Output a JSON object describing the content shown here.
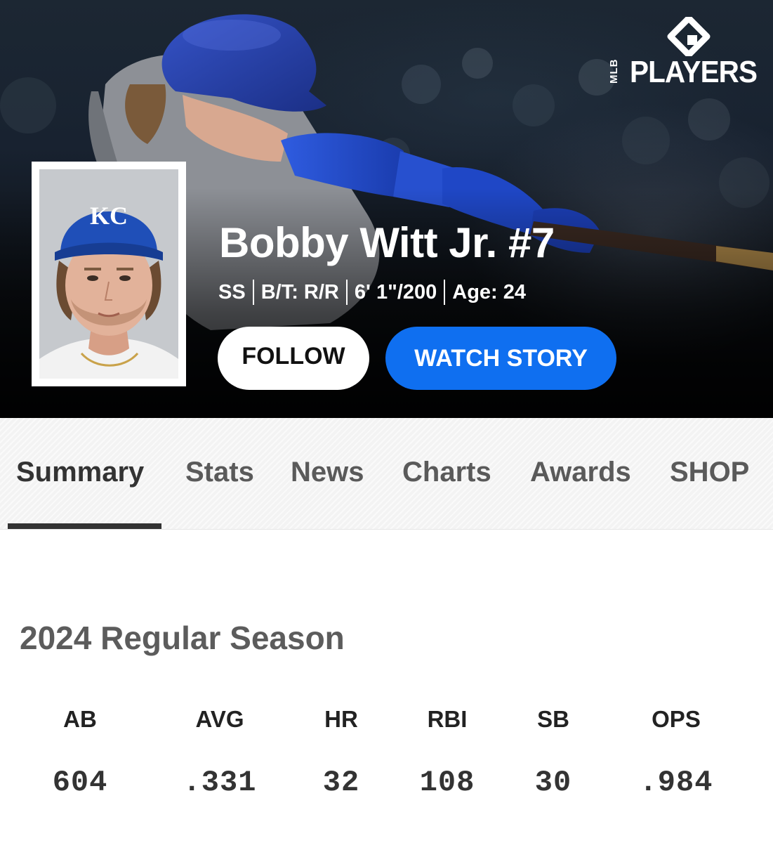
{
  "brand": {
    "logo_small": "MLB",
    "logo_word": "PLAYERS",
    "logo_icon": "mlb-players-diamond-icon"
  },
  "player": {
    "name": "Bobby Witt Jr. #7",
    "position": "SS",
    "bats_throws": "B/T: R/R",
    "height_weight": "6' 1\"/200",
    "age": "Age: 24",
    "team_logo_text": "KC"
  },
  "actions": {
    "follow_label": "FOLLOW",
    "watch_label": "WATCH STORY"
  },
  "colors": {
    "accent_blue": "#0f6ff0",
    "royals_blue": "#1d4fb5",
    "tab_active": "#333333",
    "tab_inactive": "#5a5a5a"
  },
  "tabs": [
    {
      "label": "Summary",
      "active": true
    },
    {
      "label": "Stats",
      "active": false
    },
    {
      "label": "News",
      "active": false
    },
    {
      "label": "Charts",
      "active": false
    },
    {
      "label": "Awards",
      "active": false
    },
    {
      "label": "SHOP",
      "active": false
    }
  ],
  "season": {
    "title": "2024 Regular Season",
    "stats": [
      {
        "label": "AB",
        "value": "604"
      },
      {
        "label": "AVG",
        "value": ".331"
      },
      {
        "label": "HR",
        "value": "32"
      },
      {
        "label": "RBI",
        "value": "108"
      },
      {
        "label": "SB",
        "value": "30"
      },
      {
        "label": "OPS",
        "value": ".984"
      }
    ]
  }
}
